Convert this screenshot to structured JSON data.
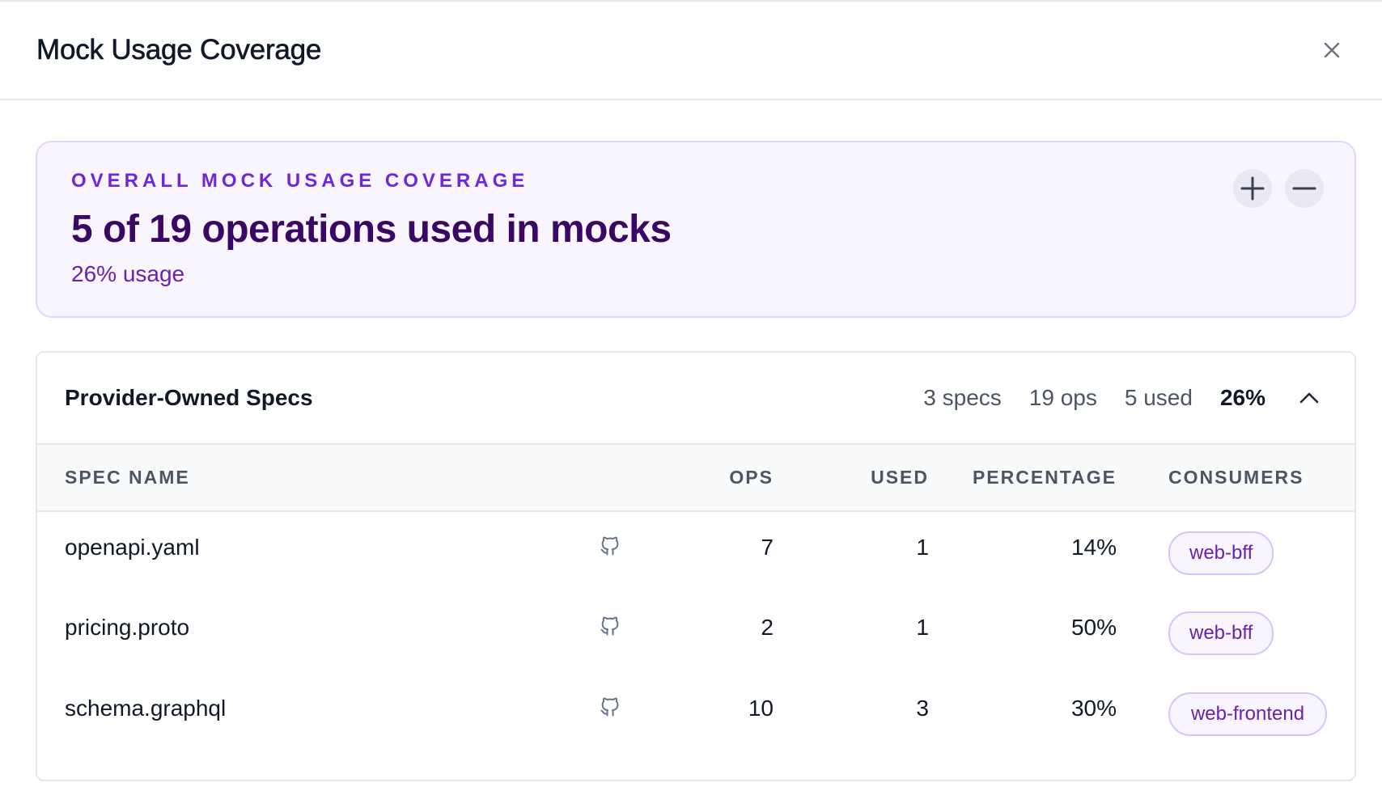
{
  "modal": {
    "title": "Mock Usage Coverage"
  },
  "summary": {
    "eyebrow": "OVERALL MOCK USAGE COVERAGE",
    "headline": "5 of 19 operations used in mocks",
    "subline": "26% usage",
    "zoom_in_icon": "plus-icon",
    "zoom_out_icon": "minus-icon"
  },
  "section": {
    "title": "Provider-Owned Specs",
    "stats": {
      "specs": "3 specs",
      "ops": "19 ops",
      "used": "5 used",
      "percentage": "26%"
    },
    "collapse_icon": "chevron-up-icon",
    "columns": {
      "spec_name": "SPEC NAME",
      "ops": "OPS",
      "used": "USED",
      "percentage": "PERCENTAGE",
      "consumers": "CONSUMERS"
    },
    "rows": [
      {
        "spec_name": "openapi.yaml",
        "ops": "7",
        "used": "1",
        "percentage": "14%",
        "consumer": "web-bff"
      },
      {
        "spec_name": "pricing.proto",
        "ops": "2",
        "used": "1",
        "percentage": "50%",
        "consumer": "web-bff"
      },
      {
        "spec_name": "schema.graphql",
        "ops": "10",
        "used": "3",
        "percentage": "30%",
        "consumer": "web-frontend"
      }
    ]
  },
  "colors": {
    "accent": "#6d28d9",
    "headline": "#3b0764",
    "card_bg": "#f9f5ff",
    "card_border": "#e4d4fb"
  }
}
